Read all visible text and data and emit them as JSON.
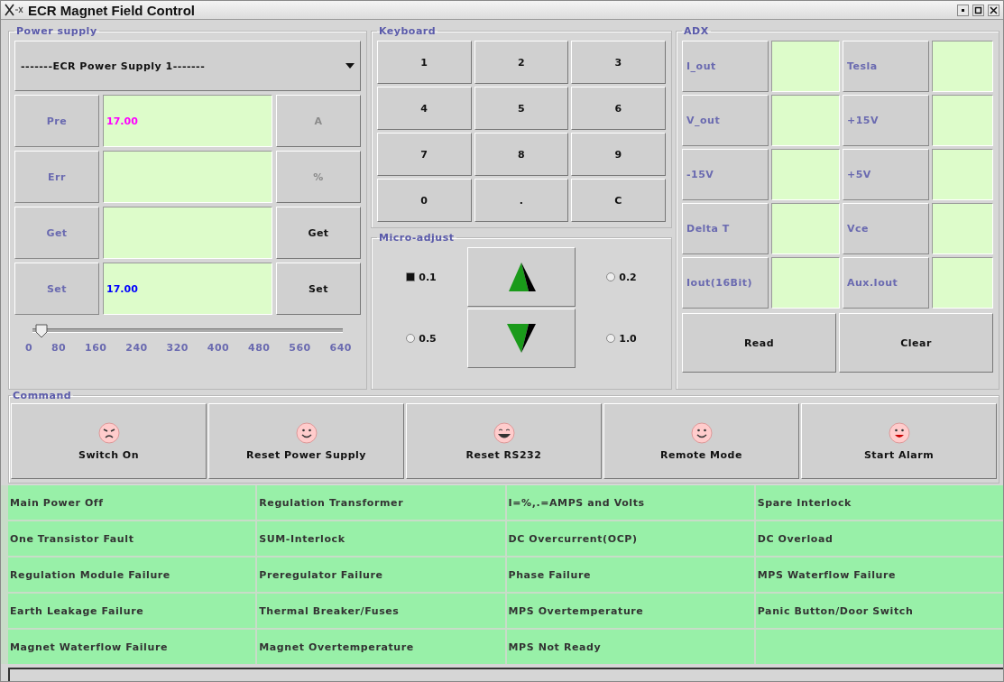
{
  "window": {
    "title": "ECR Magnet Field Control"
  },
  "power_supply": {
    "title": "Power supply",
    "selector": "-------ECR Power Supply 1-------",
    "rows": [
      {
        "label": "Pre",
        "value": "17.00",
        "color": "#ff00ff",
        "action": "A",
        "disabled": true
      },
      {
        "label": "Err",
        "action": "%",
        "disabled": true
      },
      {
        "label": "Get",
        "action": "Get",
        "disabled": false
      },
      {
        "label": "Set",
        "value": "17.00",
        "color": "#0000ff",
        "action": "Set",
        "disabled": false
      }
    ],
    "slider": {
      "level": 0.03,
      "ticks": [
        "0",
        "80",
        "160",
        "240",
        "320",
        "400",
        "480",
        "560",
        "640"
      ]
    }
  },
  "keyboard": {
    "title": "Keyboard",
    "keys": [
      "1",
      "2",
      "3",
      "4",
      "5",
      "6",
      "7",
      "8",
      "9",
      "0",
      ".",
      "C"
    ]
  },
  "micro_adjust": {
    "title": "Micro-adjust",
    "steps": [
      {
        "label": "0.1",
        "selected": true
      },
      {
        "label": "0.2",
        "selected": false
      },
      {
        "label": "0.5",
        "selected": false
      },
      {
        "label": "1.0",
        "selected": false
      }
    ]
  },
  "adx": {
    "title": "ADX",
    "readings": [
      {
        "label": "I_out"
      },
      {
        "label": "Tesla"
      },
      {
        "label": "V_out"
      },
      {
        "label": "+15V"
      },
      {
        "label": "-15V"
      },
      {
        "label": "+5V"
      },
      {
        "label": "Delta T"
      },
      {
        "label": "Vce"
      },
      {
        "label": "Iout(16Bit)"
      },
      {
        "label": "Aux.Iout"
      }
    ],
    "buttons": [
      "Read",
      "Clear"
    ]
  },
  "command": {
    "title": "Command",
    "buttons": [
      "Switch On",
      "Reset Power Supply",
      "Reset RS232",
      "Remote Mode",
      "Start Alarm"
    ]
  },
  "interlocks": [
    "Main Power Off",
    "Regulation Transformer",
    "I=%,.=AMPS and Volts",
    "Spare Interlock",
    "One Transistor Fault",
    "SUM-Interlock",
    "DC Overcurrent(OCP)",
    "DC Overload",
    "Regulation Module Failure",
    "Preregulator Failure",
    "Phase Failure",
    "MPS Waterflow Failure",
    "Earth Leakage Failure",
    "Thermal Breaker/Fuses",
    "MPS Overtemperature",
    "Panic Button/Door Switch",
    "Magnet Waterflow Failure",
    "Magnet Overtemperature",
    "MPS Not Ready"
  ]
}
